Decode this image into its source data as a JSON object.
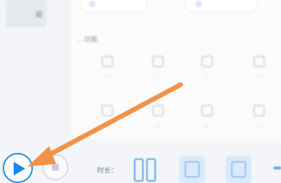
{
  "sidebar": {
    "selected_label": "· 服"
  },
  "content": {
    "section_label": "…功能",
    "tiles": [
      {
        "caption": "…"
      },
      {
        "caption": "…"
      },
      {
        "caption": "…"
      },
      {
        "caption": "…"
      },
      {
        "caption": "…"
      },
      {
        "caption": "…"
      },
      {
        "caption": "…"
      },
      {
        "caption": "…"
      }
    ]
  },
  "playback": {
    "play_icon": "play-icon",
    "stop_icon": "stop-icon",
    "duration_label": "时长：",
    "duration_digits": [
      "0",
      "0"
    ]
  },
  "colors": {
    "accent": "#1e88e5",
    "annotation_arrow": "#f0934a",
    "sidebar_bg": "#f2f4f7"
  }
}
